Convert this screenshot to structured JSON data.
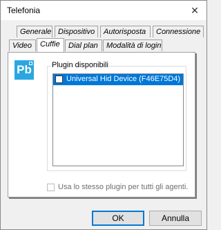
{
  "window": {
    "title": "Telefonia",
    "close_glyph": "✕"
  },
  "tabs": {
    "row_back": [
      "Generale",
      "Dispositivo",
      "Autorisposta",
      "Connessione"
    ],
    "row_front": [
      "Video",
      "Cuffie",
      "Dial plan",
      "Modalità di login"
    ],
    "active": "Cuffie"
  },
  "panel": {
    "logo_text": "Pb",
    "group_label": "Plugin disponibili",
    "plugins": [
      {
        "name": "Universal Hid Device (F46E75D4)",
        "checked": false,
        "selected": true
      }
    ],
    "all_agents_label": "Usa lo stesso plugin per tutti gli agenti.",
    "all_agents_checked": false
  },
  "buttons": {
    "ok": "OK",
    "cancel": "Annulla"
  },
  "colors": {
    "logo": "#2aa7e0",
    "selection": "#0078d7"
  }
}
